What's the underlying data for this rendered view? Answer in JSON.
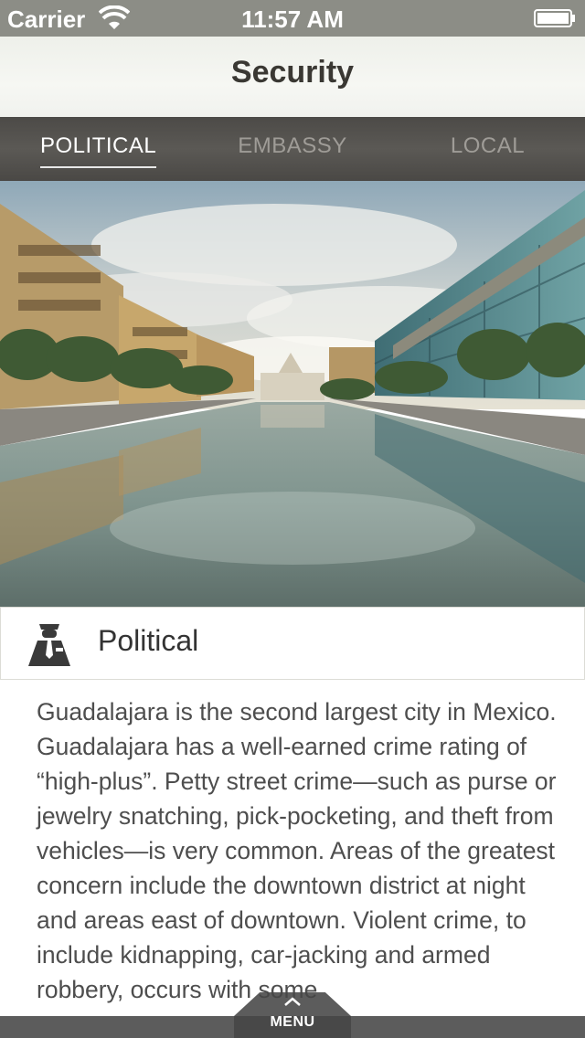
{
  "status_bar": {
    "carrier": "Carrier",
    "time": "11:57 AM",
    "icons": [
      "wifi-icon",
      "battery-icon"
    ]
  },
  "nav": {
    "title": "Security"
  },
  "tabs": [
    {
      "label": "POLITICAL",
      "active": true
    },
    {
      "label": "EMBASSY",
      "active": false
    },
    {
      "label": "LOCAL",
      "active": false
    }
  ],
  "hero": {
    "icon": "city-photo"
  },
  "section": {
    "icon": "police-officer-icon",
    "title": "Political"
  },
  "body": {
    "text": "Guadalajara is the second largest city in Mexico. Guadalajara has a well-earned crime rating of “high-plus”. Petty street crime—such as purse or jewelry snatching, pick-pocketing, and theft from vehicles—is very common. Areas of the greatest concern include the downtown district at night and areas east of downtown. Violent crime, to include kidnapping, car-jacking and armed robbery, occurs with some"
  },
  "menu": {
    "label": "MENU",
    "icon": "chevron-up-icon"
  },
  "colors": {
    "status_bar": "#8c8d86",
    "tab_bar": "#545250",
    "text": "#4e4e4e"
  }
}
